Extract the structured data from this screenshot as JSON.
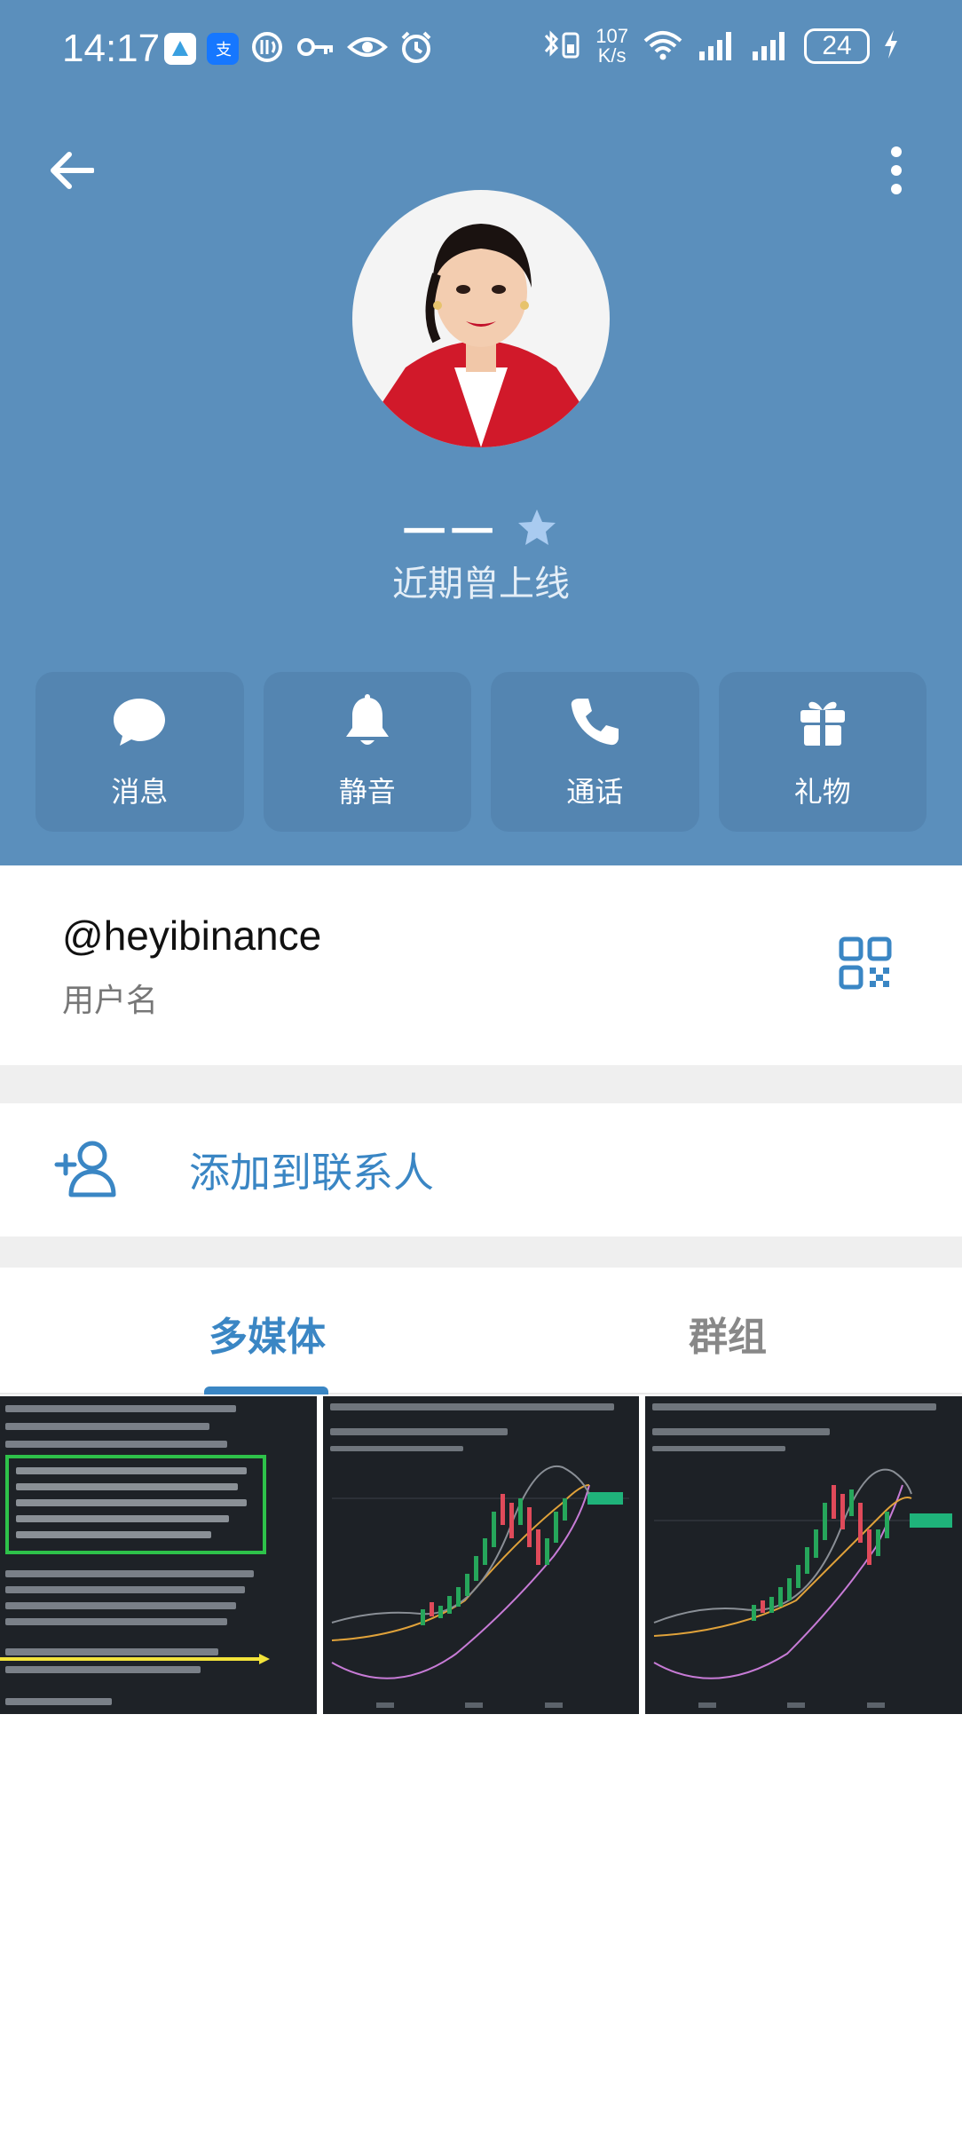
{
  "status_bar": {
    "time": "14:17",
    "net_speed_value": "107",
    "net_speed_unit": "K/s",
    "signal_type": "6",
    "battery": "24"
  },
  "profile": {
    "name": "一一",
    "status": "近期曾上线",
    "verified_icon": "star-badge-icon"
  },
  "actions": [
    {
      "label": "消息",
      "icon": "message-icon"
    },
    {
      "label": "静音",
      "icon": "bell-icon"
    },
    {
      "label": "通话",
      "icon": "phone-icon"
    },
    {
      "label": "礼物",
      "icon": "gift-icon"
    }
  ],
  "username": {
    "value": "@heyibinance",
    "caption": "用户名"
  },
  "add_contact": {
    "label": "添加到联系人"
  },
  "tabs": [
    {
      "label": "多媒体",
      "active": true
    },
    {
      "label": "群组",
      "active": false
    }
  ],
  "colors": {
    "header_bg": "#5b8fbc",
    "action_bg": "#5485b1",
    "accent": "#3a86c4"
  }
}
